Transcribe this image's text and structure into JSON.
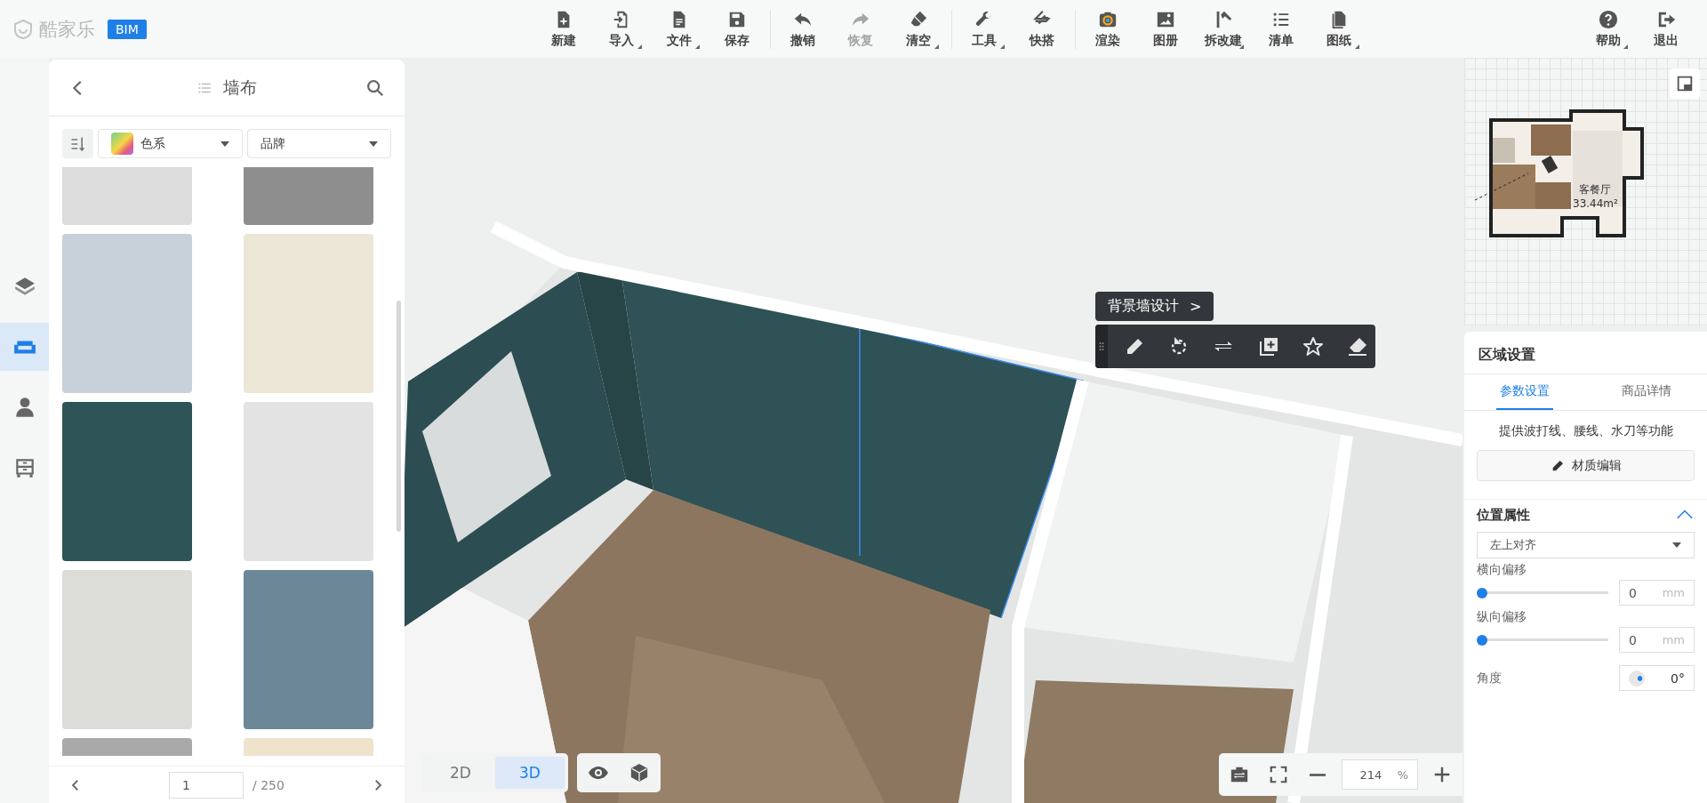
{
  "logo": {
    "name": "酷家乐",
    "badge": "BIM"
  },
  "toolbar": {
    "groups": [
      [
        {
          "label": "新建",
          "dropdown": false,
          "disabled": false
        },
        {
          "label": "导入",
          "dropdown": true,
          "disabled": false
        },
        {
          "label": "文件",
          "dropdown": true,
          "disabled": false
        },
        {
          "label": "保存",
          "dropdown": false,
          "disabled": false
        }
      ],
      [
        {
          "label": "撤销",
          "dropdown": false,
          "disabled": false
        },
        {
          "label": "恢复",
          "dropdown": false,
          "disabled": true
        },
        {
          "label": "清空",
          "dropdown": true,
          "disabled": false
        }
      ],
      [
        {
          "label": "工具",
          "dropdown": true,
          "disabled": false
        },
        {
          "label": "快搭",
          "dropdown": false,
          "disabled": false
        }
      ],
      [
        {
          "label": "渲染",
          "dropdown": false,
          "disabled": false
        },
        {
          "label": "图册",
          "dropdown": false,
          "disabled": false
        },
        {
          "label": "拆改建",
          "dropdown": true,
          "disabled": false
        },
        {
          "label": "清单",
          "dropdown": false,
          "disabled": false
        },
        {
          "label": "图纸",
          "dropdown": true,
          "disabled": false
        }
      ]
    ],
    "right": [
      {
        "label": "帮助",
        "dropdown": true,
        "disabled": false
      },
      {
        "label": "退出",
        "dropdown": false,
        "disabled": false
      }
    ]
  },
  "side_tools": [
    {
      "selected": false
    },
    {
      "selected": true
    },
    {
      "selected": false
    },
    {
      "selected": false
    }
  ],
  "catalog": {
    "title": "墙布",
    "filters": [
      {
        "label": "色系",
        "kind": "color"
      },
      {
        "label": "品牌",
        "kind": "plain"
      }
    ],
    "swatches": [
      {
        "color": "#dcdcdc"
      },
      {
        "color": "#8e8e8e"
      },
      {
        "color": "#c8d1da"
      },
      {
        "color": "#ebe6d5"
      },
      {
        "color": "#2f5458"
      },
      {
        "color": "#e3e3e3"
      },
      {
        "color": "#dcdcd8"
      },
      {
        "color": "#6c8797"
      },
      {
        "color": "#a9a9a9"
      },
      {
        "color": "#efe3cc"
      }
    ],
    "page": "1",
    "total": "/ 250"
  },
  "context_menu": {
    "title": "背景墙设计",
    "chevron": ">"
  },
  "view_toggle": [
    {
      "label": "2D",
      "selected": false
    },
    {
      "label": "3D",
      "selected": true
    }
  ],
  "zoom": {
    "value": "214",
    "unit": "%"
  },
  "minimap": {
    "room": "客餐厅",
    "area": "33.44m²"
  },
  "panel": {
    "title": "区域设置",
    "tabs": [
      {
        "label": "参数设置",
        "selected": true
      },
      {
        "label": "商品详情",
        "selected": false
      }
    ],
    "hint": "提供波打线、腰线、水刀等功能",
    "edit_button": "材质编辑",
    "section": {
      "title": "位置属性",
      "expanded": true
    },
    "align": "左上对齐",
    "offsets": [
      {
        "label": "横向偏移",
        "level": 0,
        "value": "0",
        "unit": "mm"
      },
      {
        "label": "纵向偏移",
        "level": 0,
        "value": "0",
        "unit": "mm"
      }
    ],
    "angle": {
      "label": "角度",
      "value": "0°"
    }
  }
}
